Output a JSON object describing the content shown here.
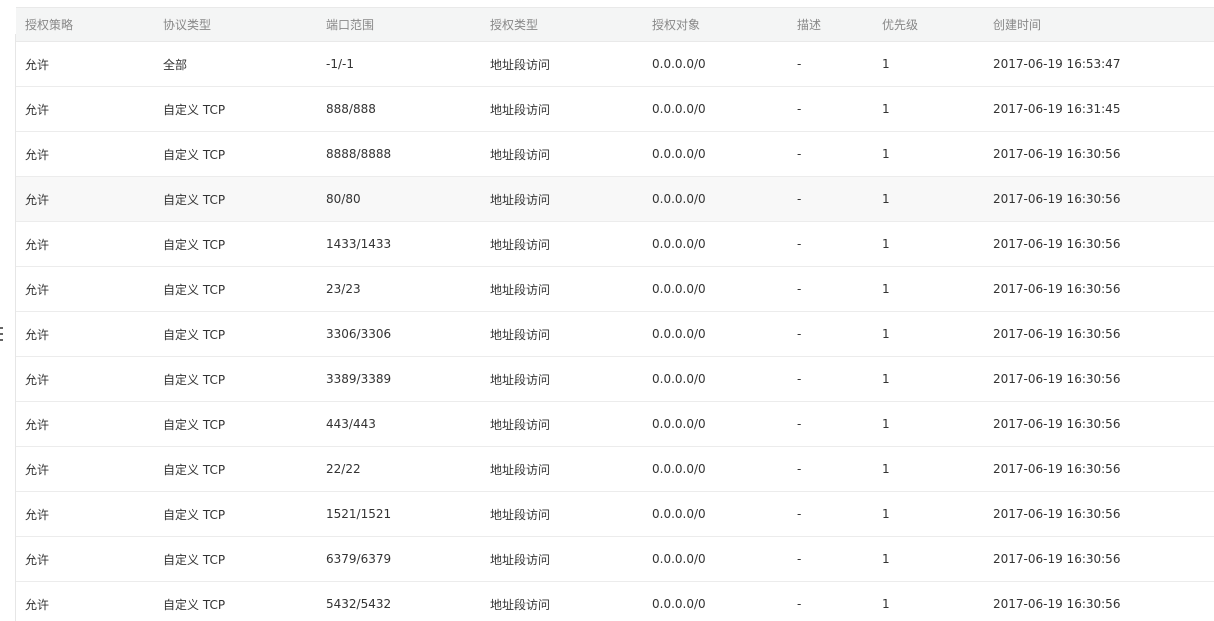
{
  "table": {
    "columns": [
      "授权策略",
      "协议类型",
      "端口范围",
      "授权类型",
      "授权对象",
      "描述",
      "优先级",
      "创建时间"
    ],
    "rows": [
      {
        "policy": "允许",
        "protocol": "全部",
        "port": "-1/-1",
        "auth_type": "地址段访问",
        "auth_object": "0.0.0.0/0",
        "desc": "-",
        "priority": "1",
        "created": "2017-06-19 16:53:47"
      },
      {
        "policy": "允许",
        "protocol": "自定义 TCP",
        "port": "888/888",
        "auth_type": "地址段访问",
        "auth_object": "0.0.0.0/0",
        "desc": "-",
        "priority": "1",
        "created": "2017-06-19 16:31:45"
      },
      {
        "policy": "允许",
        "protocol": "自定义 TCP",
        "port": "8888/8888",
        "auth_type": "地址段访问",
        "auth_object": "0.0.0.0/0",
        "desc": "-",
        "priority": "1",
        "created": "2017-06-19 16:30:56"
      },
      {
        "policy": "允许",
        "protocol": "自定义 TCP",
        "port": "80/80",
        "auth_type": "地址段访问",
        "auth_object": "0.0.0.0/0",
        "desc": "-",
        "priority": "1",
        "created": "2017-06-19 16:30:56"
      },
      {
        "policy": "允许",
        "protocol": "自定义 TCP",
        "port": "1433/1433",
        "auth_type": "地址段访问",
        "auth_object": "0.0.0.0/0",
        "desc": "-",
        "priority": "1",
        "created": "2017-06-19 16:30:56"
      },
      {
        "policy": "允许",
        "protocol": "自定义 TCP",
        "port": "23/23",
        "auth_type": "地址段访问",
        "auth_object": "0.0.0.0/0",
        "desc": "-",
        "priority": "1",
        "created": "2017-06-19 16:30:56"
      },
      {
        "policy": "允许",
        "protocol": "自定义 TCP",
        "port": "3306/3306",
        "auth_type": "地址段访问",
        "auth_object": "0.0.0.0/0",
        "desc": "-",
        "priority": "1",
        "created": "2017-06-19 16:30:56"
      },
      {
        "policy": "允许",
        "protocol": "自定义 TCP",
        "port": "3389/3389",
        "auth_type": "地址段访问",
        "auth_object": "0.0.0.0/0",
        "desc": "-",
        "priority": "1",
        "created": "2017-06-19 16:30:56"
      },
      {
        "policy": "允许",
        "protocol": "自定义 TCP",
        "port": "443/443",
        "auth_type": "地址段访问",
        "auth_object": "0.0.0.0/0",
        "desc": "-",
        "priority": "1",
        "created": "2017-06-19 16:30:56"
      },
      {
        "policy": "允许",
        "protocol": "自定义 TCP",
        "port": "22/22",
        "auth_type": "地址段访问",
        "auth_object": "0.0.0.0/0",
        "desc": "-",
        "priority": "1",
        "created": "2017-06-19 16:30:56"
      },
      {
        "policy": "允许",
        "protocol": "自定义 TCP",
        "port": "1521/1521",
        "auth_type": "地址段访问",
        "auth_object": "0.0.0.0/0",
        "desc": "-",
        "priority": "1",
        "created": "2017-06-19 16:30:56"
      },
      {
        "policy": "允许",
        "protocol": "自定义 TCP",
        "port": "6379/6379",
        "auth_type": "地址段访问",
        "auth_object": "0.0.0.0/0",
        "desc": "-",
        "priority": "1",
        "created": "2017-06-19 16:30:56"
      },
      {
        "policy": "允许",
        "protocol": "自定义 TCP",
        "port": "5432/5432",
        "auth_type": "地址段访问",
        "auth_object": "0.0.0.0/0",
        "desc": "-",
        "priority": "1",
        "created": "2017-06-19 16:30:56"
      }
    ]
  },
  "colors": {
    "header_bg": "#f4f5f5",
    "header_text": "#888888",
    "row_hover_bg": "#f8f8f8",
    "border": "#ececec",
    "text": "#333333"
  },
  "icons": {
    "sidebar_handle": "drag-handle-icon"
  }
}
